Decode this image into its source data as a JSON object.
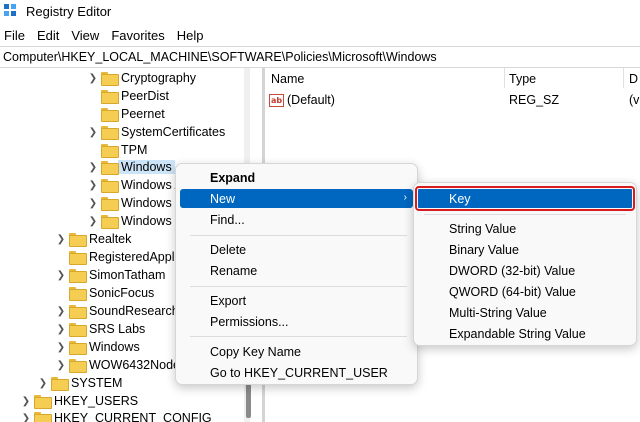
{
  "window": {
    "title": "Registry Editor"
  },
  "menubar": [
    "File",
    "Edit",
    "View",
    "Favorites",
    "Help"
  ],
  "address": "Computer\\HKEY_LOCAL_MACHINE\\SOFTWARE\\Policies\\Microsoft\\Windows",
  "tree": [
    {
      "label": "Cryptography",
      "expander": "chevron-right"
    },
    {
      "label": "PeerDist",
      "expander": "none"
    },
    {
      "label": "Peernet",
      "expander": "none"
    },
    {
      "label": "SystemCertificates",
      "expander": "chevron-right"
    },
    {
      "label": "TPM",
      "expander": "none"
    },
    {
      "label": "Windows",
      "expander": "chevron-right",
      "selected": true
    },
    {
      "label": "Windows A",
      "expander": "chevron-right"
    },
    {
      "label": "Windows I",
      "expander": "chevron-right"
    },
    {
      "label": "Windows I",
      "expander": "chevron-right"
    },
    {
      "label": "Realtek",
      "expander": "chevron-right"
    },
    {
      "label": "RegisteredAppli",
      "expander": "none"
    },
    {
      "label": "SimonTatham",
      "expander": "chevron-right"
    },
    {
      "label": "SonicFocus",
      "expander": "none"
    },
    {
      "label": "SoundResearch",
      "expander": "chevron-right"
    },
    {
      "label": "SRS Labs",
      "expander": "chevron-right"
    },
    {
      "label": "Windows",
      "expander": "chevron-right"
    },
    {
      "label": "WOW6432Node",
      "expander": "chevron-right"
    },
    {
      "label": "SYSTEM",
      "expander": "chevron-right"
    },
    {
      "label": "HKEY_USERS",
      "expander": "chevron-right"
    },
    {
      "label": "HKEY_CURRENT_CONFIG",
      "expander": "chevron-right"
    }
  ],
  "columns": {
    "name": "Name",
    "type": "Type",
    "data": "D"
  },
  "values": [
    {
      "name": "(Default)",
      "type": "REG_SZ",
      "data": "(v",
      "icon": "string-value-icon"
    }
  ],
  "context_menu": {
    "expand": "Expand",
    "new": "New",
    "find": "Find...",
    "delete": "Delete",
    "rename": "Rename",
    "export": "Export",
    "permissions": "Permissions...",
    "copy_key_name": "Copy Key Name",
    "goto": "Go to HKEY_CURRENT_USER"
  },
  "submenu": {
    "key": "Key",
    "items": [
      "String Value",
      "Binary Value",
      "DWORD (32-bit) Value",
      "QWORD (64-bit) Value",
      "Multi-String Value",
      "Expandable String Value"
    ]
  },
  "colors": {
    "highlight": "#0067c0",
    "annotation_box": "#d61c1c",
    "folder": "#f5cd52",
    "selection": "#cce4f7"
  }
}
